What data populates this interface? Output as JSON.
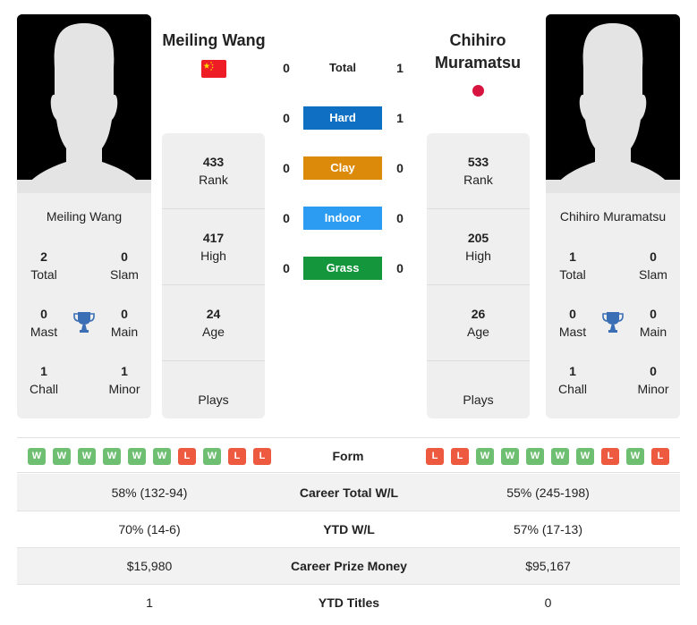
{
  "player_left": {
    "name": "Meiling Wang",
    "country_flag": "china-flag",
    "titles": {
      "total": {
        "value": "2",
        "label": "Total"
      },
      "slam": {
        "value": "0",
        "label": "Slam"
      },
      "mast": {
        "value": "0",
        "label": "Mast"
      },
      "main": {
        "value": "0",
        "label": "Main"
      },
      "chall": {
        "value": "1",
        "label": "Chall"
      },
      "minor": {
        "value": "1",
        "label": "Minor"
      }
    },
    "stats": {
      "rank": {
        "value": "433",
        "label": "Rank"
      },
      "high": {
        "value": "417",
        "label": "High"
      },
      "age": {
        "value": "24",
        "label": "Age"
      },
      "plays": {
        "value": "",
        "label": "Plays"
      }
    },
    "form": [
      "W",
      "W",
      "W",
      "W",
      "W",
      "W",
      "L",
      "W",
      "L",
      "L"
    ]
  },
  "player_right": {
    "name": "Chihiro Muramatsu",
    "country_flag": "japan-flag",
    "titles": {
      "total": {
        "value": "1",
        "label": "Total"
      },
      "slam": {
        "value": "0",
        "label": "Slam"
      },
      "mast": {
        "value": "0",
        "label": "Mast"
      },
      "main": {
        "value": "0",
        "label": "Main"
      },
      "chall": {
        "value": "1",
        "label": "Chall"
      },
      "minor": {
        "value": "0",
        "label": "Minor"
      }
    },
    "stats": {
      "rank": {
        "value": "533",
        "label": "Rank"
      },
      "high": {
        "value": "205",
        "label": "High"
      },
      "age": {
        "value": "26",
        "label": "Age"
      },
      "plays": {
        "value": "",
        "label": "Plays"
      }
    },
    "form": [
      "L",
      "L",
      "W",
      "W",
      "W",
      "W",
      "W",
      "L",
      "W",
      "L"
    ]
  },
  "head_to_head": [
    {
      "label": "Total",
      "left": "0",
      "right": "1",
      "color": ""
    },
    {
      "label": "Hard",
      "left": "0",
      "right": "1",
      "color": "#0f6fc2"
    },
    {
      "label": "Clay",
      "left": "0",
      "right": "0",
      "color": "#dc8a0a"
    },
    {
      "label": "Indoor",
      "left": "0",
      "right": "0",
      "color": "#2b9cf2"
    },
    {
      "label": "Grass",
      "left": "0",
      "right": "0",
      "color": "#13963c"
    }
  ],
  "form_label": "Form",
  "comparison": [
    {
      "label": "Career Total W/L",
      "left": "58% (132-94)",
      "right": "55% (245-198)"
    },
    {
      "label": "YTD W/L",
      "left": "70% (14-6)",
      "right": "57% (17-13)"
    },
    {
      "label": "Career Prize Money",
      "left": "$15,980",
      "right": "$95,167"
    },
    {
      "label": "YTD Titles",
      "left": "1",
      "right": "0"
    }
  ],
  "colors": {
    "win": "#6fbf73",
    "loss": "#ee5a40",
    "trophy": "#3a6fb5"
  }
}
